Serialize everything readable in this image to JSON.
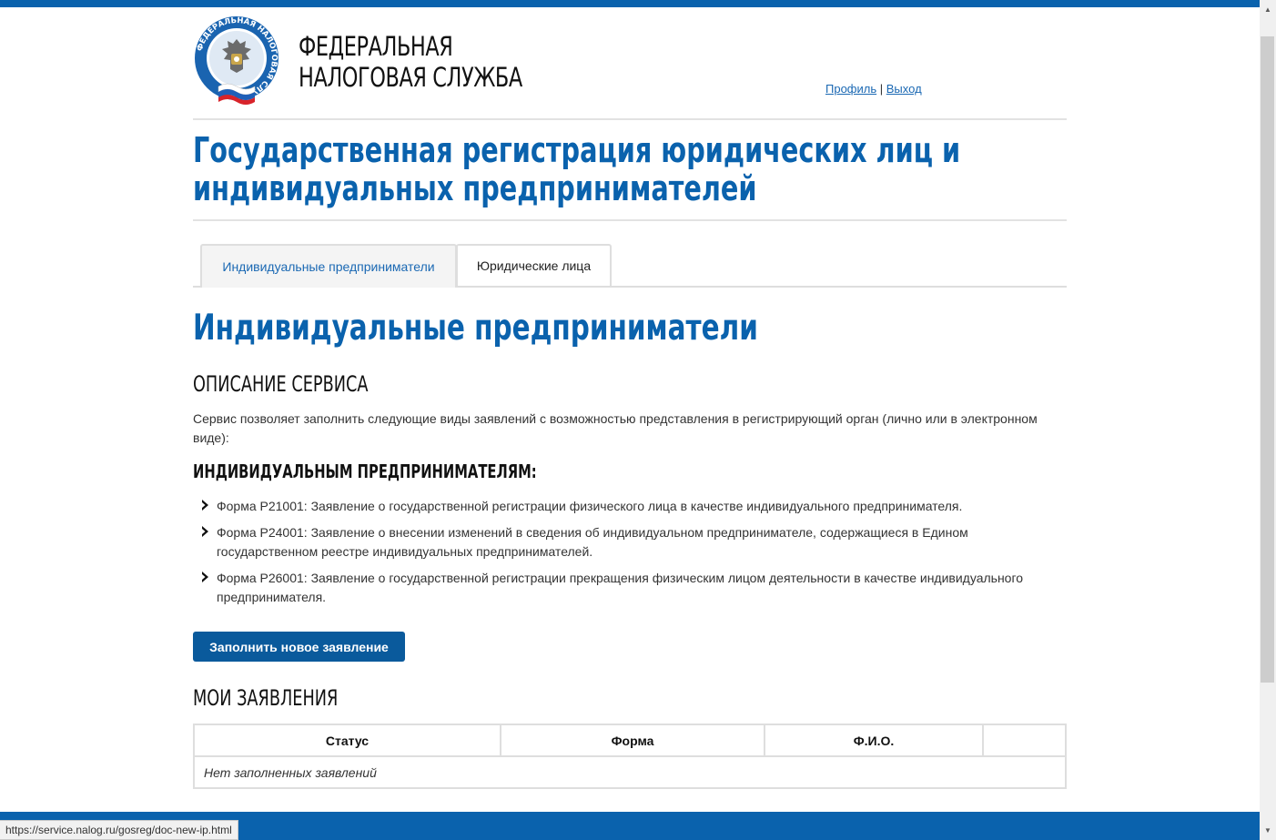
{
  "header": {
    "brand_line1": "ФЕДЕРАЛЬНАЯ",
    "brand_line2": "НАЛОГОВАЯ СЛУЖБА",
    "logo_icon": "fns-emblem-icon",
    "logo_ring_text": "ФЕДЕРАЛЬНАЯ НАЛОГОВАЯ СЛУЖБА",
    "profile_link": "Профиль",
    "separator": "|",
    "logout_link": "Выход"
  },
  "page_title_line1": "Государственная регистрация юридических лиц и",
  "page_title_line2": "индивидуальных предпринимателей",
  "tabs": [
    {
      "label": "Индивидуальные предприниматели",
      "active": true
    },
    {
      "label": "Юридические лица",
      "active": false
    }
  ],
  "content": {
    "heading": "Индивидуальные предприниматели",
    "desc_heading": "ОПИСАНИЕ СЕРВИСА",
    "desc_text": "Сервис позволяет заполнить следующие виды заявлений с возможностью представления в регистрирующий орган (лично или в электронном виде):",
    "ip_heading": "ИНДИВИДУАЛЬНЫМ ПРЕДПРИНИМАТЕЛЯМ:",
    "forms": [
      "Форма Р21001: Заявление о государственной регистрации физического лица в качестве индивидуального предпринимателя.",
      "Форма Р24001: Заявление о внесении изменений в сведения об индивидуальном предпринимателе, содержащиеся в Едином государственном реестре индивидуальных предпринимателей.",
      "Форма Р26001: Заявление о государственной регистрации прекращения физическим лицом деятельности в качестве индивидуального предпринимателя."
    ],
    "new_button": "Заполнить новое заявление",
    "my_heading": "МОИ ЗАЯВЛЕНИЯ",
    "table": {
      "columns": [
        "Статус",
        "Форма",
        "Ф.И.О.",
        ""
      ],
      "empty_text": "Нет заполненных заявлений"
    }
  },
  "status_bar_url": "https://service.nalog.ru/gosreg/doc-new-ip.html",
  "colors": {
    "brand_blue": "#0a62ad",
    "link_blue": "#1a68b3",
    "button_blue": "#0a5a9c"
  }
}
